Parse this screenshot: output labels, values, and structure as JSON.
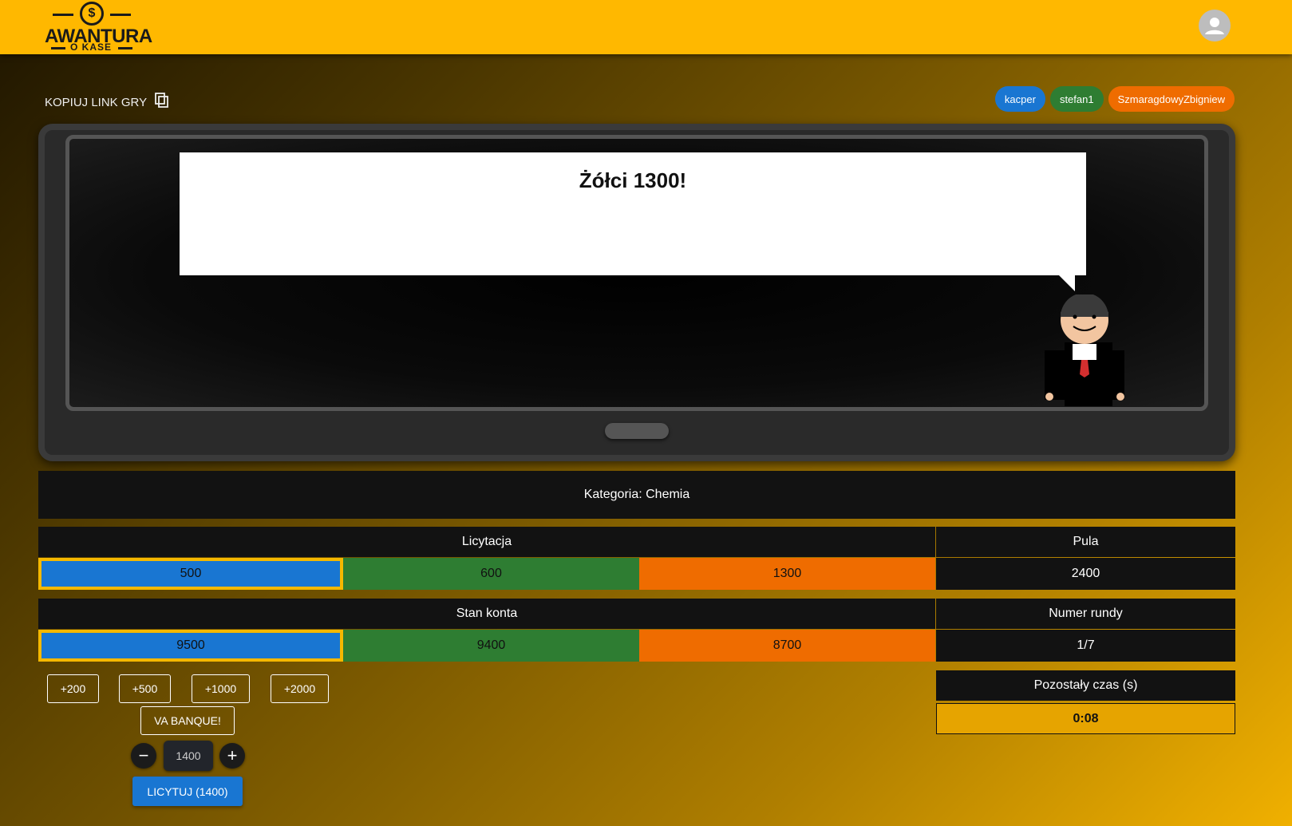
{
  "header": {
    "logo_line1": "AWANTURA",
    "logo_line2": "O KASE",
    "logo_coin": "$",
    "avatar_icon": "account-circle-icon"
  },
  "game_link": {
    "label": "KOPIUJ LINK GRY",
    "icon": "copy-icon"
  },
  "players": [
    {
      "name": "kacper",
      "color": "#1976d2"
    },
    {
      "name": "stefan1",
      "color": "#2e7d32"
    },
    {
      "name": "SzmaragdowyZbigniew",
      "color": "#ef6c00"
    }
  ],
  "speech_text": "Żółci 1300!",
  "category": "Kategoria: Chemia",
  "bidding": {
    "title": "Licytacja",
    "values": [
      "500",
      "600",
      "1300"
    ]
  },
  "pool": {
    "title": "Pula",
    "value": "2400"
  },
  "balance": {
    "title": "Stan konta",
    "values": [
      "9500",
      "9400",
      "8700"
    ]
  },
  "round": {
    "title": "Numer rundy",
    "value": "1/7"
  },
  "timer": {
    "title": "Pozostały czas (s)",
    "value": "0:08"
  },
  "quick_bids": [
    "+200",
    "+500",
    "+1000",
    "+2000"
  ],
  "va_banque": "VA BANQUE!",
  "bid_amount": "1400",
  "bid_button": "LICYTUJ (1400)",
  "colors": {
    "header": "#ffb800",
    "blue": "#1976d2",
    "green": "#2e7d32",
    "orange": "#ef6c00",
    "selected_border": "#f5b800"
  }
}
